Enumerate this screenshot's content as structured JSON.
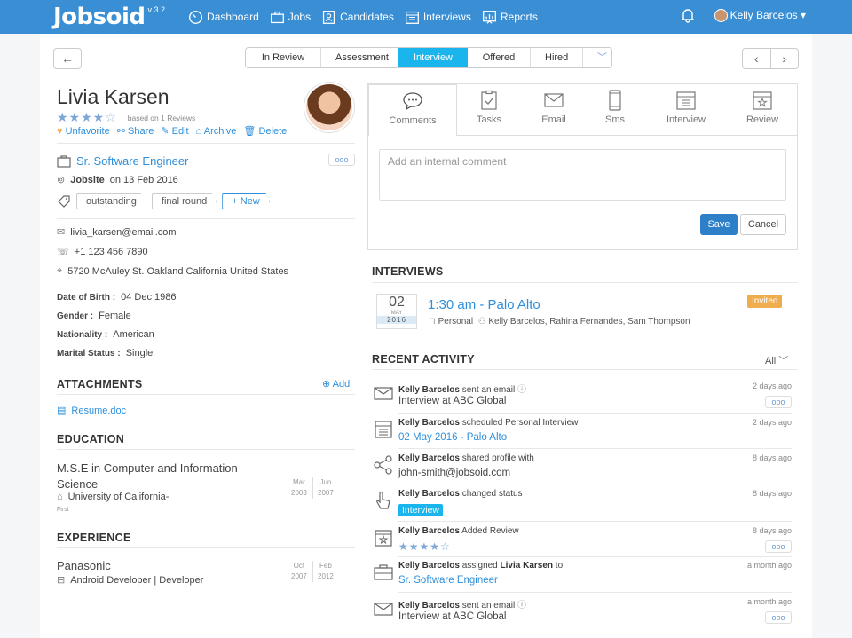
{
  "topbar": {
    "logo": "Jobsoid",
    "version": "v 3.2",
    "nav": [
      "Dashboard",
      "Jobs",
      "Candidates",
      "Interviews",
      "Reports"
    ],
    "user": "Kelly Barcelos"
  },
  "stages": [
    "In Review",
    "Assessment",
    "Interview",
    "Offered",
    "Hired"
  ],
  "candidate": {
    "name": "Livia Karsen",
    "rating": 4,
    "reviews": "based on 1 Reviews",
    "actions": [
      "Unfavorite",
      "Share",
      "Edit",
      "Archive",
      "Delete"
    ],
    "job": "Sr. Software Engineer",
    "source": "Jobsite",
    "source_date": "on 13 Feb 2016",
    "tags": [
      "outstanding",
      "final round"
    ],
    "new_tag": "+ New",
    "email": "livia_karsen@email.com",
    "phone": "+1 123 456 7890",
    "address": "5720 McAuley St. Oakland California United States",
    "dob_label": "Date of Birth :",
    "dob": "04 Dec 1986",
    "gender_label": "Gender :",
    "gender": "Female",
    "nationality_label": "Nationality :",
    "nationality": "American",
    "marital_label": "Marital Status :",
    "marital": "Single"
  },
  "attachments": {
    "title": "ATTACHMENTS",
    "add": "Add",
    "file": "Resume.doc"
  },
  "education": {
    "title": "EDUCATION",
    "degree_line1": "M.S.E in Computer and Information",
    "degree_line2": "Science",
    "school": "University of California-",
    "school2": "First",
    "from_m": "Mar",
    "from_y": "2003",
    "to_m": "Jun",
    "to_y": "2007"
  },
  "experience": {
    "title": "EXPERIENCE",
    "company": "Panasonic",
    "role": "Android Developer | Developer",
    "from_m": "Oct",
    "from_y": "2007",
    "to_m": "Feb",
    "to_y": "2012"
  },
  "tabs": [
    "Comments",
    "Tasks",
    "Email",
    "Sms",
    "Interview",
    "Review"
  ],
  "comment": {
    "placeholder": "Add an internal comment",
    "save": "Save",
    "cancel": "Cancel"
  },
  "interviews": {
    "title": "INTERVIEWS",
    "day": "02",
    "month": "MAY",
    "year": "2016",
    "time": "1:30 am - Palo Alto",
    "type": "Personal",
    "people": "Kelly Barcelos, Rahina Fernandes, Sam Thompson",
    "status": "Invited"
  },
  "activity": {
    "title": "RECENT ACTIVITY",
    "filter": "All",
    "items": [
      {
        "who": "Kelly Barcelos",
        "what": "sent an email",
        "sub": "Interview at ABC Global",
        "time": "2 days ago"
      },
      {
        "who": "Kelly Barcelos",
        "what": "scheduled Personal Interview",
        "sub": "02 May 2016 - Palo Alto",
        "time": "2 days ago"
      },
      {
        "who": "Kelly Barcelos",
        "what": "shared profile with",
        "sub": "john-smith@jobsoid.com",
        "time": "8 days ago"
      },
      {
        "who": "Kelly Barcelos",
        "what": "changed status",
        "sub": "Interview",
        "time": "8 days ago"
      },
      {
        "who": "Kelly Barcelos",
        "what": "Added Review",
        "sub": "★★★★☆",
        "time": "8 days ago"
      },
      {
        "who": "Kelly Barcelos",
        "what": "assigned",
        "extra": "Livia Karsen",
        "what2": "to",
        "sub": "Sr. Software Engineer",
        "time": "a month ago"
      },
      {
        "who": "Kelly Barcelos",
        "what": "sent an email",
        "sub": "Interview at ABC Global",
        "time": "a month ago"
      }
    ]
  },
  "colors": {
    "primary": "#3a8fd4",
    "accent": "#1ab5ec",
    "invited": "#f0ad4e",
    "link": "#2f8fdb"
  }
}
